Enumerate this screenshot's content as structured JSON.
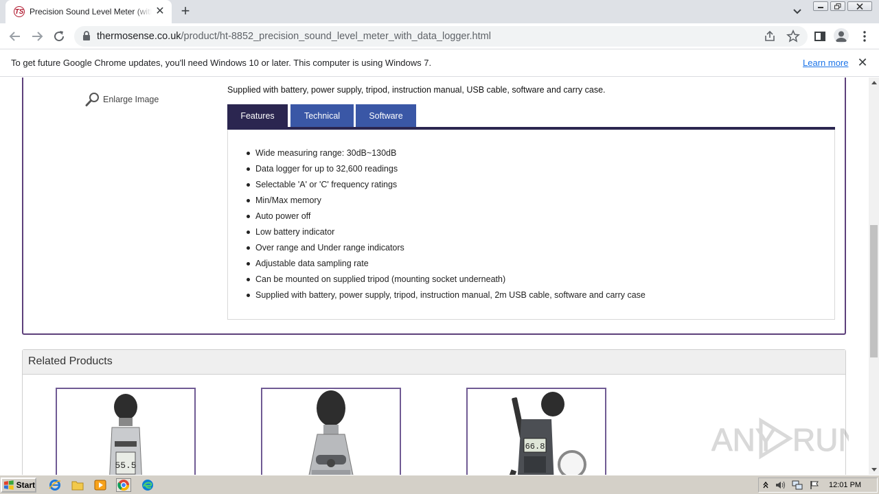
{
  "browser": {
    "tab_title": "Precision Sound Level Meter (with Data Logger)",
    "favicon_text": "TS",
    "url_host": "thermosense.co.uk",
    "url_path": "/product/ht-8852_precision_sound_level_meter_with_data_logger.html"
  },
  "infobar": {
    "message": "To get future Google Chrome updates, you'll need Windows 10 or later. This computer is using Windows 7.",
    "link_label": "Learn more"
  },
  "product": {
    "enlarge_label": "Enlarge Image",
    "supplied_text": "Supplied with battery, power supply, tripod, instruction manual, USB cable, software and carry case.",
    "tabs": [
      "Features",
      "Technical",
      "Software"
    ],
    "active_tab": "Features",
    "features": [
      "Wide measuring range: 30dB~130dB",
      "Data logger for up to 32,600 readings",
      "Selectable 'A' or 'C' frequency ratings",
      "Min/Max memory",
      "Auto power off",
      "Low battery indicator",
      "Over range and Under range indicators",
      "Adjustable data sampling rate",
      "Can be mounted on supplied tripod (mounting socket underneath)",
      "Supplied with battery, power supply, tripod, instruction manual, 2m USB cable, software and carry case"
    ]
  },
  "related": {
    "heading": "Related Products",
    "meter_readings": [
      "55.5",
      "66.8"
    ]
  },
  "watermark": {
    "left": "ANY",
    "right": "RUN"
  },
  "taskbar": {
    "start_label": "Start",
    "clock": "12:01 PM"
  },
  "colors": {
    "tab_active": "#2b2650",
    "tab_inactive": "#3a57a6",
    "box_border": "#5c3f7a",
    "link": "#1a73e8"
  }
}
